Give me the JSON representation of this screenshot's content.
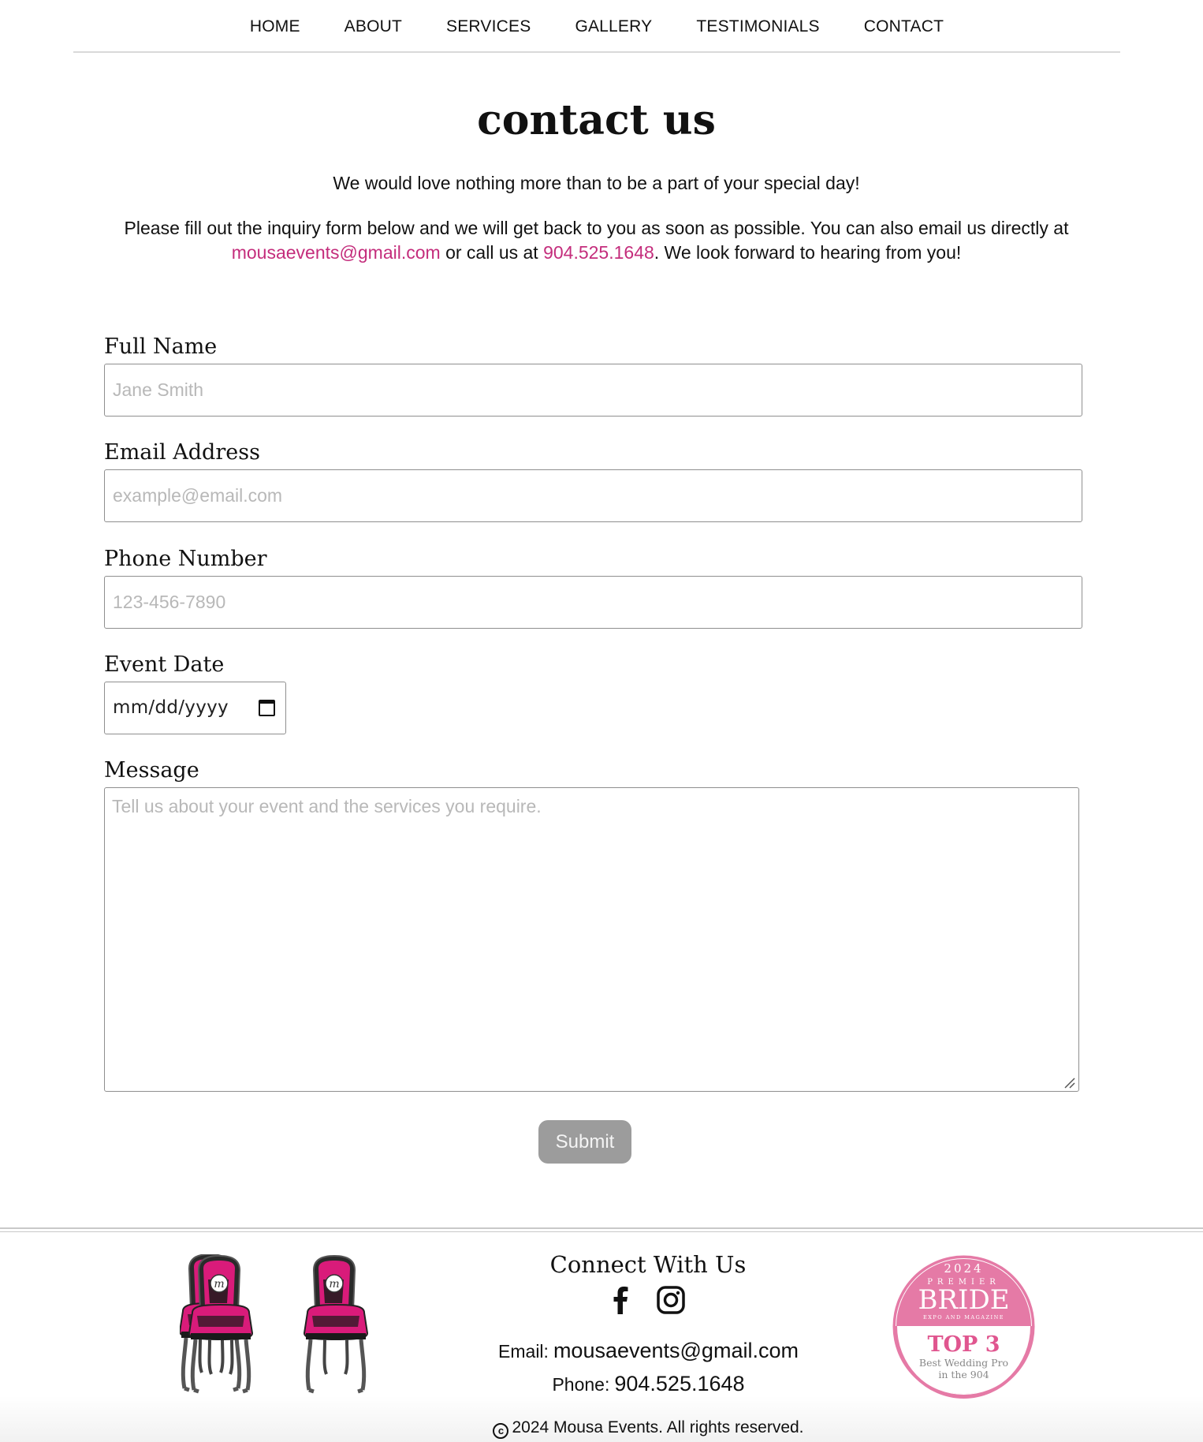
{
  "nav": {
    "items": [
      {
        "label": "HOME"
      },
      {
        "label": "ABOUT"
      },
      {
        "label": "SERVICES"
      },
      {
        "label": "GALLERY"
      },
      {
        "label": "TESTIMONIALS"
      },
      {
        "label": "CONTACT"
      }
    ]
  },
  "page": {
    "title": "contact us",
    "intro1": "We would love nothing more than to be a part of your special day!",
    "intro2_pre": "Please fill out the inquiry form below and we will get back to you as soon as possible. You can also email us directly at ",
    "intro2_email": "mousaevents@gmail.com",
    "intro2_mid": " or call us at ",
    "intro2_phone": "904.525.1648",
    "intro2_post": ". We look forward to hearing from you!"
  },
  "form": {
    "name": {
      "label": "Full Name",
      "placeholder": "Jane Smith",
      "value": ""
    },
    "email": {
      "label": "Email Address",
      "placeholder": "example@email.com",
      "value": ""
    },
    "phone": {
      "label": "Phone Number",
      "placeholder": "123-456-7890",
      "value": ""
    },
    "date": {
      "label": "Event Date",
      "placeholder": "mm/dd/yyyy"
    },
    "message": {
      "label": "Message",
      "placeholder": "Tell us about your event and the services you require.",
      "value": ""
    },
    "submit_label": "Submit"
  },
  "footer": {
    "connect_title": "Connect With Us",
    "social": [
      {
        "icon": "facebook-icon"
      },
      {
        "icon": "instagram-icon"
      }
    ],
    "email_label": "Email:",
    "email_value": "mousaevents@gmail.com",
    "phone_label": "Phone:",
    "phone_value": "904.525.1648",
    "copyright": "2024 Mousa Events. All rights reserved.",
    "logo_letter": "m",
    "badge": {
      "year": "2024",
      "premier": "PREMIER",
      "brand": "BRIDE",
      "tagline": "EXPO AND MAGAZINE",
      "rank": "TOP 3",
      "line1": "Best Wedding Pro",
      "line2": "in the 904"
    }
  },
  "colors": {
    "accent": "#c42d7c",
    "chair_pink": "#d91b7a",
    "badge_pink": "#e57aa6",
    "submit_bg": "#9c9c9c"
  }
}
